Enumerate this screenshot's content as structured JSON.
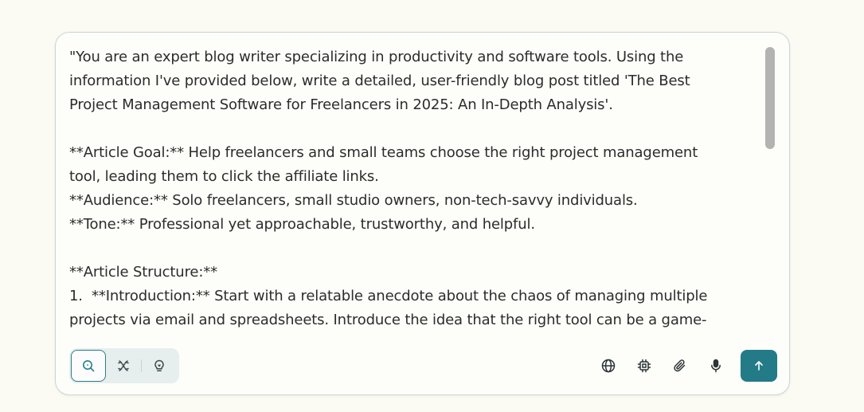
{
  "prompt": {
    "lines": [
      "\"You are an expert blog writer specializing in productivity and software tools. Using the",
      "information I've provided below, write a detailed, user-friendly blog post titled 'The Best",
      "Project Management Software for Freelancers in 2025: An In-Depth Analysis'.",
      "",
      "**Article Goal:** Help freelancers and small teams choose the right project management",
      "tool, leading them to click the affiliate links.",
      "**Audience:** Solo freelancers, small studio owners, non-tech-savvy individuals.",
      "**Tone:** Professional yet approachable, trustworthy, and helpful.",
      "",
      "**Article Structure:**",
      "1.  **Introduction:** Start with a relatable anecdote about the chaos of managing multiple",
      "projects via email and spreadsheets. Introduce the idea that the right tool can be a game-"
    ]
  },
  "toolbar": {
    "modes": [
      {
        "icon": "search-icon",
        "active": true
      },
      {
        "icon": "research-icon",
        "active": false
      },
      {
        "icon": "lightbulb-icon",
        "active": false
      }
    ],
    "actions": [
      {
        "icon": "globe-icon"
      },
      {
        "icon": "cpu-chip-icon"
      },
      {
        "icon": "paperclip-icon"
      },
      {
        "icon": "microphone-icon"
      }
    ],
    "send_icon": "arrow-up-icon"
  },
  "colors": {
    "accent": "#237b88",
    "page_background": "#fbfaf3",
    "text": "#2c2c2c"
  }
}
